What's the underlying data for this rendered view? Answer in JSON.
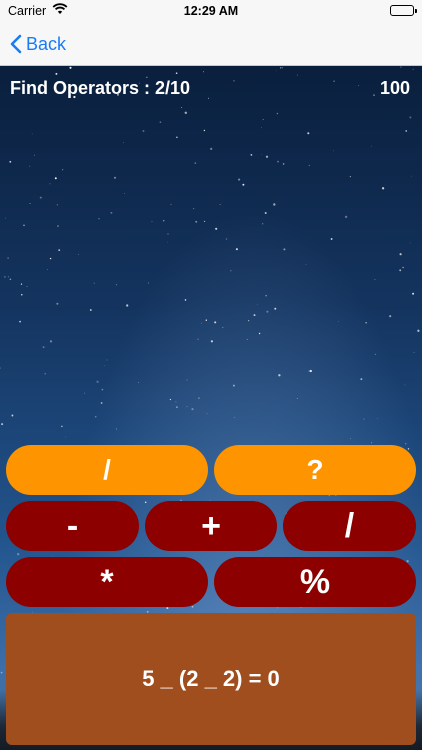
{
  "status_bar": {
    "carrier": "Carrier",
    "time": "12:29 AM",
    "icons": [
      "wifi-icon",
      "battery-icon"
    ]
  },
  "nav": {
    "back_label": "Back",
    "back_icon": "chevron-left-icon",
    "tint_color": "#1a7cf5"
  },
  "game": {
    "title": "Find Operators : 2/10",
    "score": "100",
    "answer_buttons": [
      "/",
      "?"
    ],
    "operator_buttons_row1": [
      "-",
      "+",
      "/"
    ],
    "operator_buttons_row2": [
      "*",
      "%"
    ],
    "equation": "5 _ (2 _ 2) = 0"
  },
  "colors": {
    "answer_button": "#fe9400",
    "operator_button": "#8c0000",
    "equation_panel": "#a14e1e"
  }
}
